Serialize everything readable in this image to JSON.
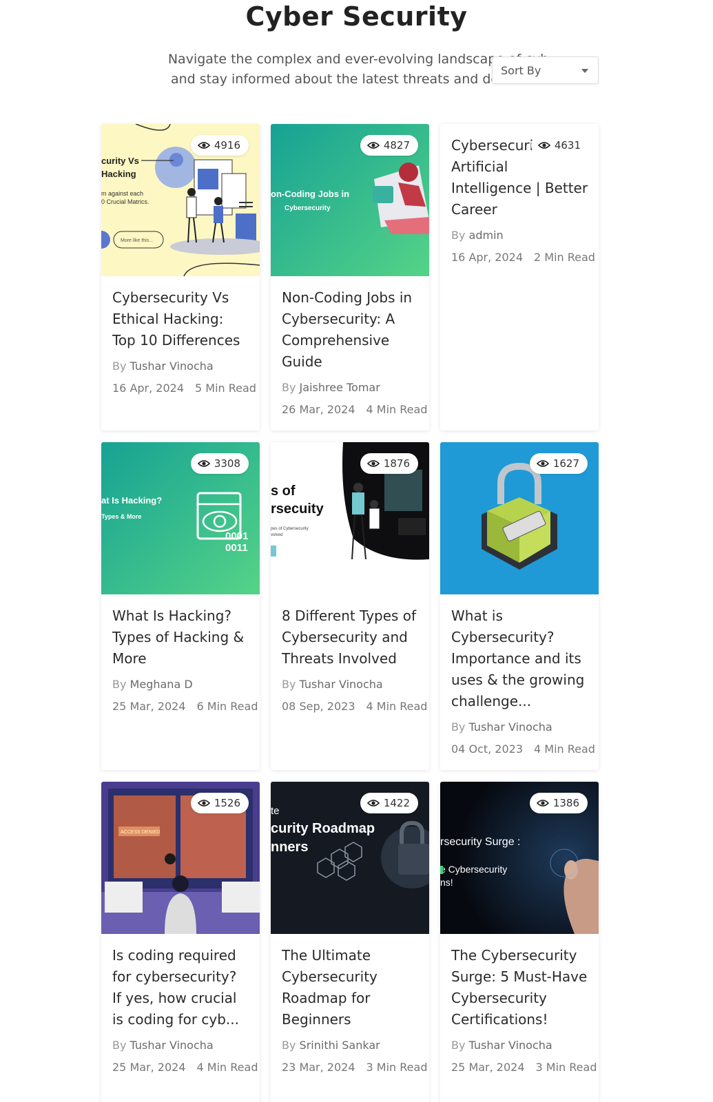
{
  "page": {
    "title": "Cyber Security",
    "subtitle_line1": "Navigate the complex and ever-evolving landscape of cyb",
    "subtitle_line2": "and stay informed about the latest threats and defense s",
    "sort_label": "Sort By"
  },
  "cards": [
    {
      "views": "4916",
      "title": "Cybersecurity Vs Ethical Hacking: Top 10 Differences",
      "by": "By",
      "author": "Tushar Vinocha",
      "date": "16 Apr, 2024",
      "read": "5 Min Read",
      "thumb_text": [
        "curity Vs",
        "Hacking",
        "m against each",
        "0 Crucial Matrics.",
        "More like this..."
      ]
    },
    {
      "views": "4827",
      "title": "Non-Coding Jobs in Cybersecurity: A Comprehensive Guide",
      "by": "By",
      "author": "Jaishree Tomar",
      "date": "26 Mar, 2024",
      "read": "4 Min Read",
      "thumb_text": [
        "on-Coding Jobs in",
        "Cybersecurity"
      ]
    },
    {
      "views": "4631",
      "title": "Cybersecuri Artificial Intelligence | Better Career",
      "by": "By",
      "author": "admin",
      "date": "16 Apr, 2024",
      "read": "2 Min Read"
    },
    {
      "views": "3308",
      "title": "What Is Hacking? Types of Hacking & More",
      "by": "By",
      "author": "Meghana D",
      "date": "25 Mar, 2024",
      "read": "6 Min Read",
      "thumb_text": [
        "at Is Hacking?",
        "Types & More",
        "0001",
        "0011"
      ]
    },
    {
      "views": "1876",
      "title": "8 Different Types of Cybersecurity and Threats Involved",
      "by": "By",
      "author": "Tushar Vinocha",
      "date": "08 Sep, 2023",
      "read": "4 Min Read",
      "thumb_text": [
        "s of",
        "rsecuity",
        "pes of Cybersecurity",
        "volved"
      ]
    },
    {
      "views": "1627",
      "title": "What is Cybersecurity? Importance and its uses & the growing challenge...",
      "by": "By",
      "author": "Tushar Vinocha",
      "date": "04 Oct, 2023",
      "read": "4 Min Read"
    },
    {
      "views": "1526",
      "title": "Is coding required for cybersecurity? If yes, how crucial is coding for cyb...",
      "by": "By",
      "author": "Tushar Vinocha",
      "date": "25 Mar, 2024",
      "read": "4 Min Read",
      "thumb_text": [
        "ACCESS DENIED"
      ]
    },
    {
      "views": "1422",
      "title": "The Ultimate Cybersecurity Roadmap for Beginners",
      "by": "By",
      "author": "Srinithi Sankar",
      "date": "23 Mar, 2024",
      "read": "3 Min Read",
      "thumb_text": [
        "te",
        "curity Roadmap",
        "nners"
      ]
    },
    {
      "views": "1386",
      "title": "The Cybersecurity Surge: 5 Must-Have Cybersecurity Certifications!",
      "by": "By",
      "author": "Tushar Vinocha",
      "date": "25 Mar, 2024",
      "read": "3 Min Read",
      "thumb_text": [
        "rsecurity Surge :",
        "e Cybersecurity",
        "ns!"
      ]
    }
  ],
  "colors": {
    "teal_start": "#1aa89a",
    "teal_end": "#4ed08a",
    "blue_bg": "#1f9ad6",
    "cream_bg": "#fdf7c3",
    "dark_bg": "#151a22"
  }
}
